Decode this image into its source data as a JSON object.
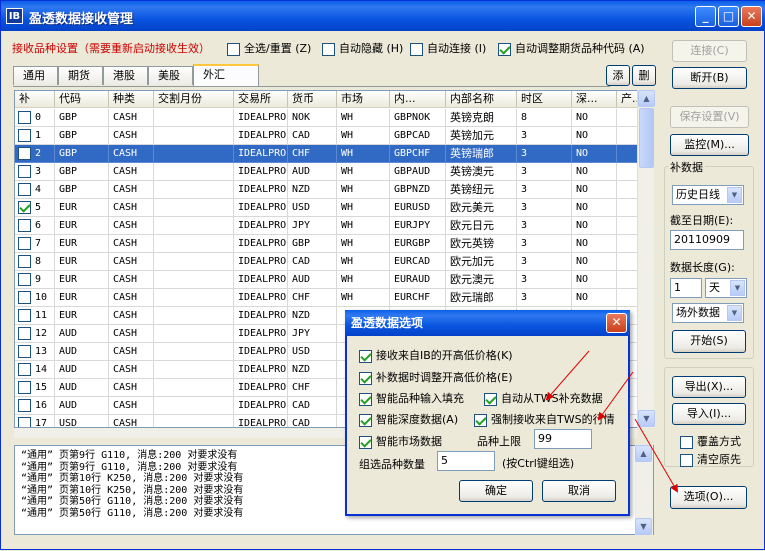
{
  "window": {
    "title": "盈透数据接收管理",
    "app_icon_text": "IB"
  },
  "options_bar": {
    "warning": "接收品种设置（需要重新启动接收生效）",
    "select_all": {
      "label": "全选/重置 (Z)",
      "checked": false
    },
    "auto_hide": {
      "label": "自动隐藏 (H)",
      "checked": false
    },
    "auto_connect": {
      "label": "自动连接 (I)",
      "checked": false
    },
    "auto_adjust": {
      "label": "自动调整期货品种代码 (A)",
      "checked": true
    }
  },
  "tabs": [
    {
      "label": "通用",
      "active": false
    },
    {
      "label": "期货",
      "active": false
    },
    {
      "label": "港股",
      "active": false
    },
    {
      "label": "美股",
      "active": false
    },
    {
      "label": "外汇",
      "active": true
    }
  ],
  "tab_actions": {
    "add": "添",
    "delete": "删"
  },
  "grid": {
    "columns": [
      "补",
      "代码",
      "种类",
      "交割月份",
      "交易所",
      "货币",
      "市场",
      "内...",
      "内部名称",
      "时区",
      "深...",
      "产..."
    ],
    "rows": [
      {
        "n": "0",
        "checked": false,
        "code": "GBP",
        "type": "CASH",
        "month": "",
        "exchange": "IDEALPRO",
        "currency": "NOK",
        "market": "WH",
        "internal": "GBPNOK",
        "name": "英镑克朗",
        "tz": "8",
        "depth": "NO",
        "selected": false
      },
      {
        "n": "1",
        "checked": false,
        "code": "GBP",
        "type": "CASH",
        "month": "",
        "exchange": "IDEALPRO",
        "currency": "CAD",
        "market": "WH",
        "internal": "GBPCAD",
        "name": "英镑加元",
        "tz": "3",
        "depth": "NO",
        "selected": false
      },
      {
        "n": "2",
        "checked": false,
        "code": "GBP",
        "type": "CASH",
        "month": "",
        "exchange": "IDEALPRO",
        "currency": "CHF",
        "market": "WH",
        "internal": "GBPCHF",
        "name": "英镑瑞郎",
        "tz": "3",
        "depth": "NO",
        "selected": true
      },
      {
        "n": "3",
        "checked": false,
        "code": "GBP",
        "type": "CASH",
        "month": "",
        "exchange": "IDEALPRO",
        "currency": "AUD",
        "market": "WH",
        "internal": "GBPAUD",
        "name": "英镑澳元",
        "tz": "3",
        "depth": "NO",
        "selected": false
      },
      {
        "n": "4",
        "checked": false,
        "code": "GBP",
        "type": "CASH",
        "month": "",
        "exchange": "IDEALPRO",
        "currency": "NZD",
        "market": "WH",
        "internal": "GBPNZD",
        "name": "英镑纽元",
        "tz": "3",
        "depth": "NO",
        "selected": false
      },
      {
        "n": "5",
        "checked": true,
        "code": "EUR",
        "type": "CASH",
        "month": "",
        "exchange": "IDEALPRO",
        "currency": "USD",
        "market": "WH",
        "internal": "EURUSD",
        "name": "欧元美元",
        "tz": "3",
        "depth": "NO",
        "selected": false
      },
      {
        "n": "6",
        "checked": false,
        "code": "EUR",
        "type": "CASH",
        "month": "",
        "exchange": "IDEALPRO",
        "currency": "JPY",
        "market": "WH",
        "internal": "EURJPY",
        "name": "欧元日元",
        "tz": "3",
        "depth": "NO",
        "selected": false
      },
      {
        "n": "7",
        "checked": false,
        "code": "EUR",
        "type": "CASH",
        "month": "",
        "exchange": "IDEALPRO",
        "currency": "GBP",
        "market": "WH",
        "internal": "EURGBP",
        "name": "欧元英镑",
        "tz": "3",
        "depth": "NO",
        "selected": false
      },
      {
        "n": "8",
        "checked": false,
        "code": "EUR",
        "type": "CASH",
        "month": "",
        "exchange": "IDEALPRO",
        "currency": "CAD",
        "market": "WH",
        "internal": "EURCAD",
        "name": "欧元加元",
        "tz": "3",
        "depth": "NO",
        "selected": false
      },
      {
        "n": "9",
        "checked": false,
        "code": "EUR",
        "type": "CASH",
        "month": "",
        "exchange": "IDEALPRO",
        "currency": "AUD",
        "market": "WH",
        "internal": "EURAUD",
        "name": "欧元澳元",
        "tz": "3",
        "depth": "NO",
        "selected": false
      },
      {
        "n": "10",
        "checked": false,
        "code": "EUR",
        "type": "CASH",
        "month": "",
        "exchange": "IDEALPRO",
        "currency": "CHF",
        "market": "WH",
        "internal": "EURCHF",
        "name": "欧元瑞郎",
        "tz": "3",
        "depth": "NO",
        "selected": false
      },
      {
        "n": "11",
        "checked": false,
        "code": "EUR",
        "type": "CASH",
        "month": "",
        "exchange": "IDEALPRO",
        "currency": "NZD",
        "market": "",
        "internal": "",
        "name": "",
        "tz": "",
        "depth": "",
        "selected": false
      },
      {
        "n": "12",
        "checked": false,
        "code": "AUD",
        "type": "CASH",
        "month": "",
        "exchange": "IDEALPRO",
        "currency": "JPY",
        "market": "",
        "internal": "",
        "name": "",
        "tz": "",
        "depth": "",
        "selected": false
      },
      {
        "n": "13",
        "checked": false,
        "code": "AUD",
        "type": "CASH",
        "month": "",
        "exchange": "IDEALPRO",
        "currency": "USD",
        "market": "",
        "internal": "",
        "name": "",
        "tz": "",
        "depth": "",
        "selected": false
      },
      {
        "n": "14",
        "checked": false,
        "code": "AUD",
        "type": "CASH",
        "month": "",
        "exchange": "IDEALPRO",
        "currency": "NZD",
        "market": "",
        "internal": "",
        "name": "",
        "tz": "",
        "depth": "",
        "selected": false
      },
      {
        "n": "15",
        "checked": false,
        "code": "AUD",
        "type": "CASH",
        "month": "",
        "exchange": "IDEALPRO",
        "currency": "CHF",
        "market": "",
        "internal": "",
        "name": "",
        "tz": "",
        "depth": "",
        "selected": false
      },
      {
        "n": "16",
        "checked": false,
        "code": "AUD",
        "type": "CASH",
        "month": "",
        "exchange": "IDEALPRO",
        "currency": "CAD",
        "market": "",
        "internal": "",
        "name": "",
        "tz": "",
        "depth": "",
        "selected": false
      },
      {
        "n": "17",
        "checked": false,
        "code": "USD",
        "type": "CASH",
        "month": "",
        "exchange": "IDEALPRO",
        "currency": "CAD",
        "market": "",
        "internal": "",
        "name": "",
        "tz": "",
        "depth": "",
        "selected": false
      }
    ]
  },
  "log": [
    "“通用” 页第9行 G110, 消息:200 对要求没有",
    "“通用” 页第9行 G110, 消息:200 对要求没有",
    "“通用” 页第10行 K250, 消息:200 对要求没有",
    "“通用” 页第10行 K250, 消息:200 对要求没有",
    "“通用” 页第50行 G110, 消息:200 对要求没有",
    "“通用” 页第50行 G110, 消息:200 对要求没有"
  ],
  "right_panel": {
    "connect": "连接(C)",
    "disconnect": "断开(B)",
    "save_settings": "保存设置(V)",
    "monitor": "监控(M)...",
    "supplement_title": "补数据",
    "period_select": "历史日线",
    "end_date_label": "截至日期(E):",
    "end_date_value": "20110909",
    "length_label": "数据长度(G):",
    "length_value": "1",
    "unit_select": "天",
    "source_select": "场外数据",
    "start": "开始(S)",
    "export": "导出(X)...",
    "import": "导入(I)...",
    "overwrite": {
      "label": "覆盖方式",
      "checked": false
    },
    "clear_original": {
      "label": "清空原先",
      "checked": false
    },
    "options": "选项(O)..."
  },
  "dialog": {
    "title": "盈透数据选项",
    "opt_ohlc_from_ib": {
      "label": "接收来自IB的开高低价格(K)",
      "checked": true
    },
    "opt_adjust_ohlc": {
      "label": "补数据时调整开高低价格(E)",
      "checked": true
    },
    "opt_smart_fill": {
      "label": "智能品种输入填充",
      "checked": true
    },
    "opt_auto_tws_fill": {
      "label": "自动从TWS补充数据",
      "checked": true
    },
    "opt_smart_depth": {
      "label": "智能深度数据(A)",
      "checked": true
    },
    "opt_force_tws_quote": {
      "label": "强制接收来自TWS的行情",
      "checked": true
    },
    "opt_smart_market": {
      "label": "智能市场数据",
      "checked": true
    },
    "limit_label": "品种上限",
    "limit_value": "99",
    "group_count_label": "组选品种数量",
    "group_count_value": "5",
    "group_hint": "(按Ctrl键组选)",
    "ok": "确定",
    "cancel": "取消"
  },
  "colors": {
    "warning": "#cc0000",
    "selection": "#316ac5",
    "title_blue": "#0a5ee8",
    "annotation": "#e00000"
  }
}
